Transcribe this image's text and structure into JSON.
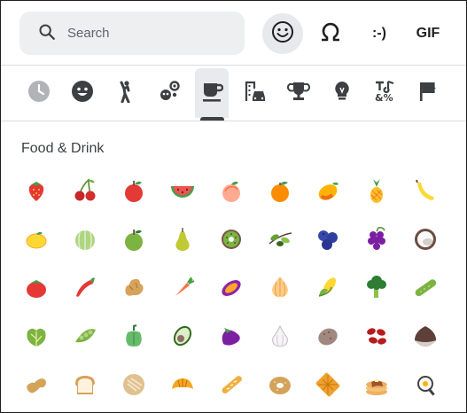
{
  "search": {
    "placeholder": "Search"
  },
  "modes": [
    {
      "name": "emoji-mode-button",
      "icon": "smiley-icon",
      "active": true
    },
    {
      "name": "symbols-mode-button",
      "icon": "omega-icon",
      "label": ""
    },
    {
      "name": "emoticons-mode-button",
      "label": ":-)"
    },
    {
      "name": "gif-mode-button",
      "label": "GIF"
    }
  ],
  "categories": [
    {
      "name": "recent",
      "icon": "clock-icon"
    },
    {
      "name": "smileys",
      "icon": "smiley-face-icon"
    },
    {
      "name": "people",
      "icon": "person-icon"
    },
    {
      "name": "animals",
      "icon": "paw-flower-icon"
    },
    {
      "name": "food-drink",
      "icon": "coffee-cup-icon",
      "active": true
    },
    {
      "name": "travel",
      "icon": "building-car-icon"
    },
    {
      "name": "activities",
      "icon": "trophy-icon"
    },
    {
      "name": "objects",
      "icon": "lightbulb-icon"
    },
    {
      "name": "symbols",
      "icon": "symbols-icon"
    },
    {
      "name": "flags",
      "icon": "flag-icon"
    }
  ],
  "section_title": "Food & Drink",
  "emojis": [
    "strawberry",
    "cherries",
    "red-apple",
    "watermelon",
    "peach",
    "tangerine",
    "mango",
    "pineapple",
    "banana",
    "lemon",
    "melon",
    "green-apple",
    "pear",
    "kiwi",
    "olive",
    "blueberries",
    "grapes",
    "coconut",
    "tomato",
    "hot-pepper",
    "ginger",
    "carrot",
    "sweet-potato",
    "onion",
    "corn",
    "broccoli",
    "cucumber",
    "leafy-green",
    "peas",
    "bell-pepper",
    "avocado",
    "eggplant",
    "garlic",
    "potato",
    "beans",
    "chestnut",
    "peanuts",
    "bread",
    "flatbread",
    "croissant",
    "baguette",
    "bagel",
    "waffle",
    "pancakes",
    "fried-egg"
  ],
  "colors": {
    "accent": "#3c4043",
    "search_bg": "#eeeff1",
    "active_bg": "#e7e9ec"
  }
}
